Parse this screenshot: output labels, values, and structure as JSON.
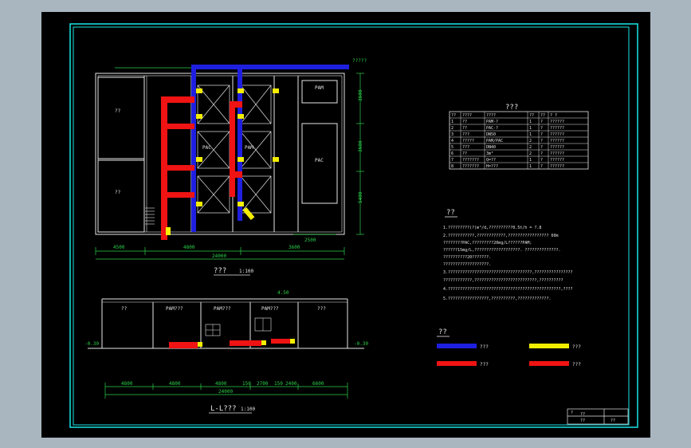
{
  "plan": {
    "title": "???",
    "scale": "1:100",
    "rooms": {
      "pam_top_right": "PAM",
      "pac_right": "PAC",
      "pac_center": "PAC",
      "pam_center": "PAM",
      "left_top": "??",
      "left_bottom": "??"
    },
    "dims": {
      "d1": "4500",
      "d2": "3600",
      "d3": "24000",
      "d4": "2500",
      "d5": "4800",
      "right1": "3600",
      "right2": "3600",
      "right3": "5400"
    },
    "markers": {
      "top_tag": "?????"
    }
  },
  "section": {
    "title": "L-L???",
    "scale": "1:100",
    "rooms": [
      "??",
      "PAM???",
      "PAM???",
      "PAM???",
      "???"
    ],
    "dims_row1": [
      "4800",
      "4800",
      "4800",
      "150",
      "2700",
      "150",
      "2400",
      "6600"
    ],
    "dims_total": "24000",
    "levels": {
      "left": "-0.30",
      "right": "-0.30",
      "top": "4.50"
    }
  },
  "table": {
    "title": "???",
    "headers": [
      "??",
      "????",
      "????",
      "??",
      "??",
      "? ?"
    ],
    "rows": [
      [
        "1",
        "??",
        "PAM-?",
        "1",
        "?",
        "??????"
      ],
      [
        "2",
        "??",
        "PAC-?",
        "1",
        "?",
        "??????"
      ],
      [
        "3",
        "???",
        "DN50",
        "1",
        "?",
        "??????"
      ],
      [
        "4",
        "?????",
        "PAM/PAC",
        "2",
        "?",
        "??????"
      ],
      [
        "5",
        "???",
        "DN40",
        "2",
        "?",
        "??????"
      ],
      [
        "6",
        "??",
        "3m³",
        "2",
        "?",
        "??????"
      ],
      [
        "7",
        "???????",
        "Q=??",
        "1",
        "?",
        "??????"
      ],
      [
        "8",
        "???????",
        "H=???",
        "1",
        "?",
        "??????"
      ]
    ]
  },
  "notes": {
    "title": "??",
    "lines": [
      "1.?????????(?)m³/d,??????????0.5t/h = ?.8",
      "2.???????????,????????????,????????????????? 60m",
      "  ????????PAC,?????????20mg/L??????PAM;",
      "  ??????15mg/L,???????????????????.   ??????????????.",
      "  ??????????20???????.",
      "  ???????????????????.",
      "3.???????????????????????????????????,????????????????",
      "  ????????????,??????????????????????????,??????????",
      "4.???????????????????????????????????????????????,????",
      "5.?????????????????,??????????,?????????????."
    ]
  },
  "legend": {
    "title": "??",
    "items": [
      {
        "label": "???",
        "color": "#1f1fe0"
      },
      {
        "label": "???",
        "color": "#f4ee00"
      },
      {
        "label": "???",
        "color": "#ef1313"
      },
      {
        "label": "???",
        "color": "#ef1313"
      }
    ]
  },
  "title_block": {
    "line1": "?",
    "line2": "??",
    "line3": "??",
    "code": "??"
  },
  "colors": {
    "blue_pipe": "#1f1fe0",
    "red_pipe": "#ef1313",
    "yellow_fitting": "#f4ee00",
    "frame": "#19e5e5",
    "walls": "#e6e6e6",
    "dims": "#2bd04a"
  }
}
